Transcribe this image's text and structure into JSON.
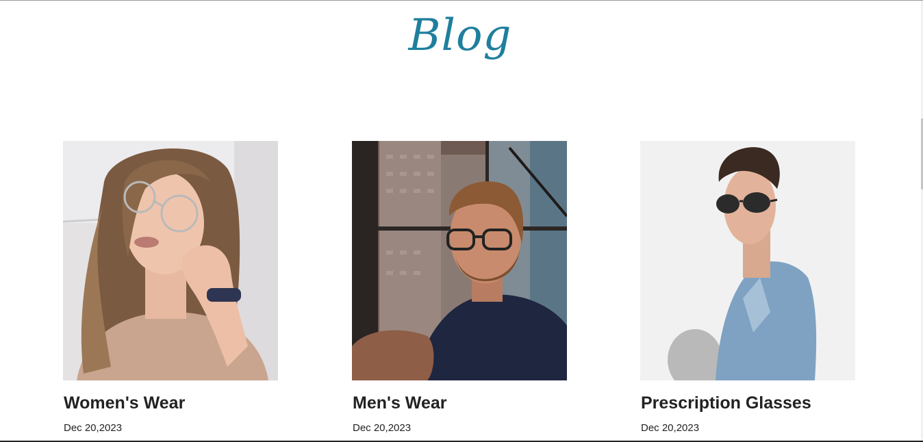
{
  "section": {
    "heading": "Blog"
  },
  "posts": [
    {
      "title": "Women's Wear",
      "date": "Dec 20,2023",
      "image": "woman-with-round-glasses-photo"
    },
    {
      "title": "Men's Wear",
      "date": "Dec 20,2023",
      "image": "man-with-glasses-city-window-photo"
    },
    {
      "title": "Prescription Glasses",
      "date": "Dec 20,2023",
      "image": "man-with-sunglasses-denim-jacket-photo"
    }
  ],
  "colors": {
    "heading": "#1f7f9d",
    "text": "#222222",
    "background": "#ffffff"
  }
}
